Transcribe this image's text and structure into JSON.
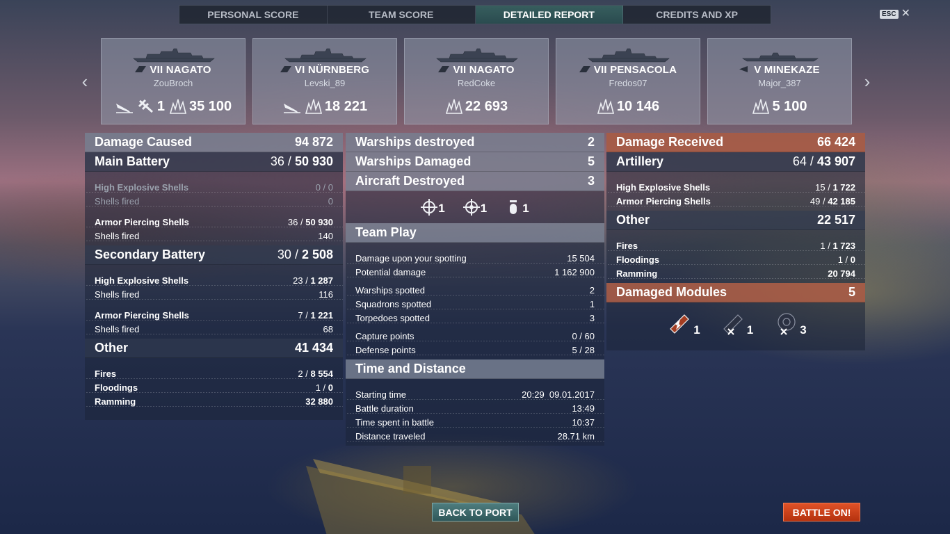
{
  "tabs": [
    "PERSONAL SCORE",
    "TEAM SCORE",
    "DETAILED REPORT",
    "CREDITS AND XP"
  ],
  "active_tab": "DETAILED REPORT",
  "esc_label": "ESC",
  "ships": [
    {
      "tier_name": "VII NAGATO",
      "player": "ZouBroch",
      "score": "35 100",
      "torpedo_ribbon": "",
      "plane_ribbon": "1",
      "icons": [
        "sink-icon",
        "plane-icon",
        "hit-icon"
      ]
    },
    {
      "tier_name": "VI NÜRNBERG",
      "player": "Levski_89",
      "score": "18 221",
      "icons": [
        "sink-icon",
        "hit-icon"
      ]
    },
    {
      "tier_name": "VII NAGATO",
      "player": "RedCoke",
      "score": "22 693",
      "icons": [
        "hit-icon"
      ]
    },
    {
      "tier_name": "VII PENSACOLA",
      "player": "Fredos07",
      "score": "10 146",
      "icons": [
        "hit-icon"
      ]
    },
    {
      "tier_name": "V MINEKAZE",
      "player": "Major_387",
      "score": "5 100",
      "icons": [
        "hit-icon"
      ]
    }
  ],
  "left": {
    "damage_caused": {
      "label": "Damage Caused",
      "value": "94 872"
    },
    "main_battery": {
      "label": "Main Battery",
      "hits": "36",
      "damage": "50 930"
    },
    "mb_he": {
      "label": "High Explosive Shells",
      "hits": "0",
      "damage": "0"
    },
    "mb_he_fired": {
      "label": "Shells fired",
      "value": "0"
    },
    "mb_ap": {
      "label": "Armor Piercing Shells",
      "hits": "36",
      "damage": "50 930"
    },
    "mb_ap_fired": {
      "label": "Shells fired",
      "value": "140"
    },
    "secondary": {
      "label": "Secondary Battery",
      "hits": "30",
      "damage": "2 508"
    },
    "sb_he": {
      "label": "High Explosive Shells",
      "hits": "23",
      "damage": "1 287"
    },
    "sb_he_fired": {
      "label": "Shells fired",
      "value": "116"
    },
    "sb_ap": {
      "label": "Armor Piercing Shells",
      "hits": "7",
      "damage": "1 221"
    },
    "sb_ap_fired": {
      "label": "Shells fired",
      "value": "68"
    },
    "other": {
      "label": "Other",
      "value": "41 434"
    },
    "fires": {
      "label": "Fires",
      "hits": "2",
      "damage": "8 554"
    },
    "floodings": {
      "label": "Floodings",
      "hits": "1",
      "damage": "0"
    },
    "ramming": {
      "label": "Ramming",
      "value": "32 880"
    }
  },
  "middle": {
    "warships_destroyed": {
      "label": "Warships destroyed",
      "value": "2"
    },
    "warships_damaged": {
      "label": "Warships Damaged",
      "value": "5"
    },
    "aircraft_destroyed": {
      "label": "Aircraft Destroyed",
      "value": "3"
    },
    "aircraft_icons": [
      {
        "icon": "fighter-crosshair-icon",
        "value": "1"
      },
      {
        "icon": "bomber-crosshair-icon",
        "value": "1"
      },
      {
        "icon": "bomb-icon",
        "value": "1"
      }
    ],
    "team_play": "Team Play",
    "spotting_damage": {
      "label": "Damage upon your spotting",
      "value": "15 504"
    },
    "potential_damage": {
      "label": "Potential damage",
      "value": "1 162 900"
    },
    "warships_spotted": {
      "label": "Warships spotted",
      "value": "2"
    },
    "squadrons_spotted": {
      "label": "Squadrons spotted",
      "value": "1"
    },
    "torpedoes_spotted": {
      "label": "Torpedoes spotted",
      "value": "3"
    },
    "capture_points": {
      "label": "Capture points",
      "value": "0 / 60"
    },
    "defense_points": {
      "label": "Defense points",
      "value": "5 / 28"
    },
    "time_distance": "Time and Distance",
    "starting_time": {
      "label": "Starting time",
      "value": "20:29  09.01.2017"
    },
    "battle_duration": {
      "label": "Battle duration",
      "value": "13:49"
    },
    "time_in_battle": {
      "label": "Time spent in battle",
      "value": "10:37"
    },
    "distance": {
      "label": "Distance traveled",
      "value": "28.71 km"
    }
  },
  "right": {
    "damage_received": {
      "label": "Damage Received",
      "value": "66 424"
    },
    "artillery": {
      "label": "Artillery",
      "hits": "64",
      "damage": "43 907"
    },
    "he": {
      "label": "High Explosive Shells",
      "hits": "15",
      "damage": "1 722"
    },
    "ap": {
      "label": "Armor Piercing Shells",
      "hits": "49",
      "damage": "42 185"
    },
    "other": {
      "label": "Other",
      "value": "22 517"
    },
    "fires": {
      "label": "Fires",
      "hits": "1",
      "damage": "1 723"
    },
    "floodings": {
      "label": "Floodings",
      "hits": "1",
      "damage": "0"
    },
    "ramming": {
      "label": "Ramming",
      "value": "20 794"
    },
    "damaged_modules": {
      "label": "Damaged Modules",
      "value": "5"
    },
    "module_icons": [
      {
        "icon": "engine-damaged-icon",
        "value": "1"
      },
      {
        "icon": "steering-destroyed-icon",
        "value": "1"
      },
      {
        "icon": "turret-destroyed-icon",
        "value": "3"
      }
    ]
  },
  "buttons": {
    "back": "BACK TO PORT",
    "battle": "BATTLE ON!"
  }
}
